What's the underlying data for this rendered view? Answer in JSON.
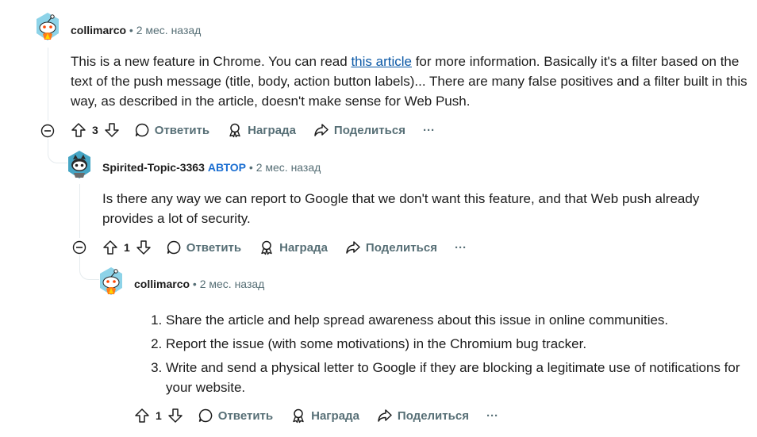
{
  "comments": [
    {
      "author": "collimarco",
      "time": "• 2 мес. назад",
      "body_before_link": "This is a new feature in Chrome. You can read ",
      "link_text": "this article",
      "body_after_link": " for more information. Basically it's a filter based on the text of the push message (title, body, action button labels)... There are many false positives and a filter built in this way, as described in the article, doesn't make sense for Web Push.",
      "votes": "3"
    },
    {
      "author": "Spirited-Topic-3363",
      "op_badge": "АВТОР",
      "time": "• 2 мес. назад",
      "body": "Is there any way we can report to Google that we don't want this feature, and that Web push already provides a lot of security.",
      "votes": "1"
    },
    {
      "author": "collimarco",
      "time": "• 2 мес. назад",
      "list_items": [
        "Share the article and help spread awareness about this issue in online communities.",
        "Report the issue (with some motivations) in the Chromium bug tracker.",
        "Write and send a physical letter to Google if they are blocking a legitimate use of notifications for your website."
      ],
      "votes": "1"
    }
  ],
  "actions": {
    "reply": "Ответить",
    "award": "Награда",
    "share": "Поделиться",
    "more": "···"
  },
  "colors": {
    "text": "#1c1c1c",
    "meta": "#576f76",
    "link": "#0a58a6",
    "op": "#1a6ed1",
    "thread": "#e5ebee"
  },
  "icons": [
    "avatar-snoo-icon",
    "upvote-icon",
    "downvote-icon",
    "comment-icon",
    "award-icon",
    "share-icon",
    "collapse-icon",
    "more-icon"
  ]
}
